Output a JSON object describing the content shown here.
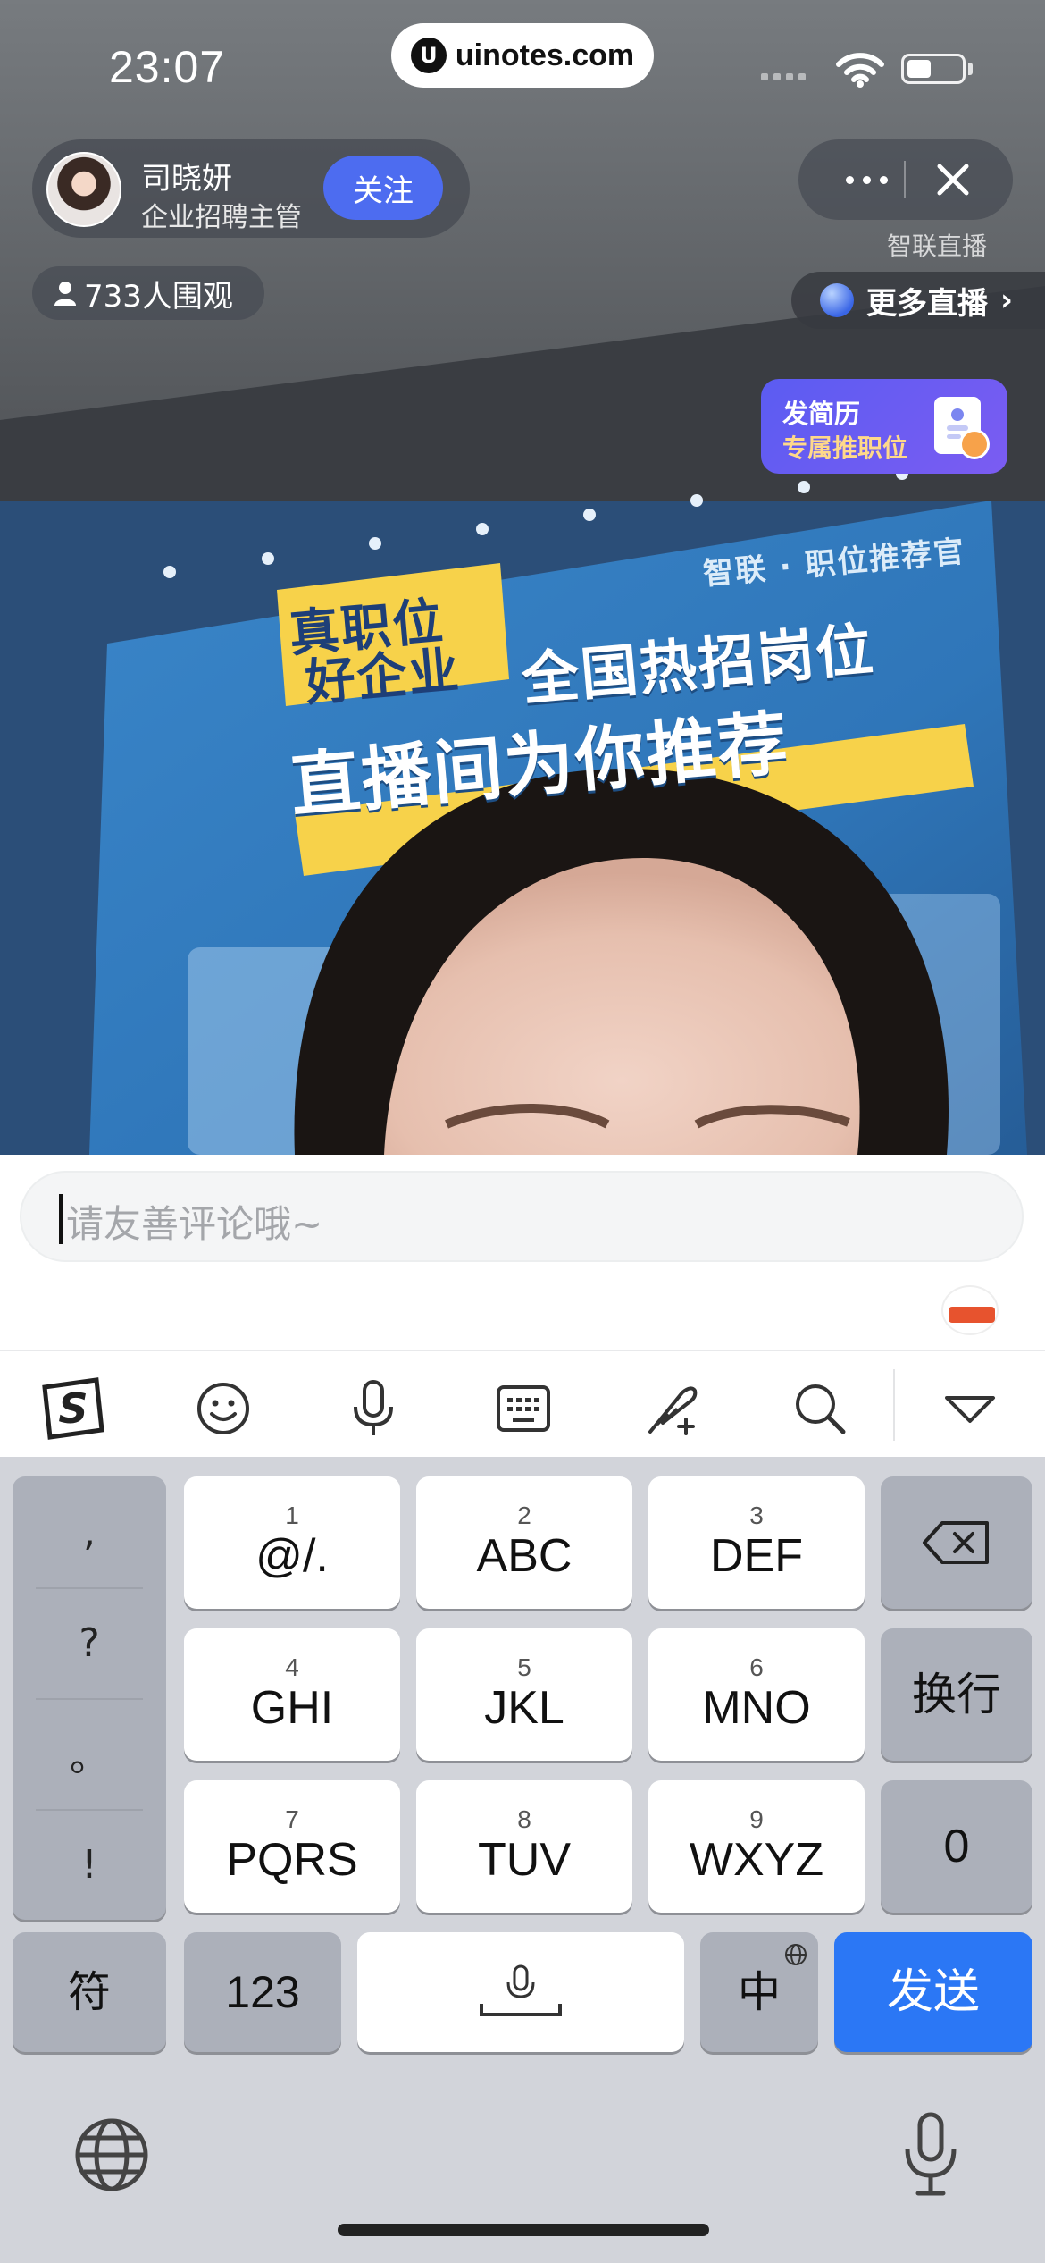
{
  "status_bar": {
    "time": "23:07",
    "url": "uinotes.com",
    "url_logo_glyph": "U"
  },
  "host": {
    "name": "司晓妍",
    "role": "企业招聘主管",
    "follow_label": "关注"
  },
  "viewers": {
    "text": "733人围观"
  },
  "controls": {
    "channel_label": "智联直播",
    "more_live_label": "更多直播",
    "more_live_chevron": "›"
  },
  "resume_card": {
    "line1": "发简历",
    "line2": "专属推职位"
  },
  "banner": {
    "line1": "真职位",
    "line2": "好企业",
    "line3": "全国热招岗位",
    "line4": "直播间为你推荐",
    "brand": "智联 · 职位推荐官"
  },
  "comment": {
    "placeholder": "请友善评论哦~"
  },
  "ime_toolbar": [
    "sogou-logo-icon",
    "emoji-icon",
    "microphone-icon",
    "keyboard-icon",
    "handwriting-icon",
    "search-icon",
    "collapse-keyboard-icon"
  ],
  "keyboard": {
    "punctuation": [
      ",",
      "?",
      "。",
      "!"
    ],
    "t9_keys": [
      {
        "num": "1",
        "label": "@/."
      },
      {
        "num": "2",
        "label": "ABC"
      },
      {
        "num": "3",
        "label": "DEF"
      },
      {
        "num": "4",
        "label": "GHI"
      },
      {
        "num": "5",
        "label": "JKL"
      },
      {
        "num": "6",
        "label": "MNO"
      },
      {
        "num": "7",
        "label": "PQRS"
      },
      {
        "num": "8",
        "label": "TUV"
      },
      {
        "num": "9",
        "label": "WXYZ"
      }
    ],
    "enter_label": "换行",
    "zero_label": "0",
    "symbol_label": "符",
    "numbers_label": "123",
    "language_label": "中",
    "send_label": "发送"
  },
  "colors": {
    "follow": "#4d6cf0",
    "send": "#2b77f5",
    "resume_card": "#5b5cf2",
    "resume_highlight": "#ffd98a"
  }
}
